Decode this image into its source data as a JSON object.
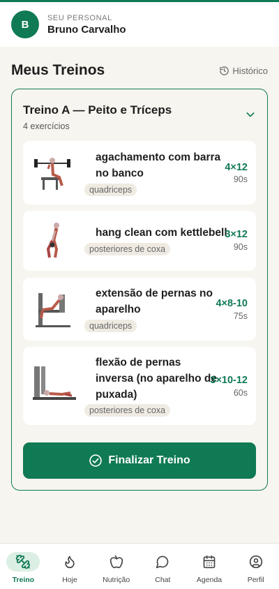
{
  "header": {
    "avatar_initial": "B",
    "role_label": "SEU PERSONAL",
    "trainer_name": "Bruno Carvalho"
  },
  "page": {
    "title": "Meus Treinos",
    "history_label": "Histórico"
  },
  "workout": {
    "name": "Treino A — Peito e Tríceps",
    "count": "4 exercícios",
    "exercises": [
      {
        "name_line1": "agachamento com barra",
        "name_line2": "no banco",
        "name_line3": "",
        "tag": "quadriceps",
        "sets": "4×12",
        "rest": "90s",
        "image": "squat-figure"
      },
      {
        "name_line1": "hang clean com kettlebell",
        "name_line2": "",
        "name_line3": "",
        "tag": "posteriores de coxa",
        "sets": "3×12",
        "rest": "90s",
        "image": "kettlebell-figure"
      },
      {
        "name_line1": "extensão de pernas no",
        "name_line2": "aparelho",
        "name_line3": "",
        "tag": "quadriceps",
        "sets": "4×8-10",
        "rest": "75s",
        "image": "leg-extension-figure"
      },
      {
        "name_line1": "flexão de pernas",
        "name_line2": "inversa (no aparelho de",
        "name_line3": "puxada)",
        "tag": "posteriores de coxa",
        "sets": "3×10-12",
        "rest": "60s",
        "image": "leg-curl-figure"
      }
    ],
    "finish_label": "Finalizar Treino"
  },
  "nav": {
    "items": [
      {
        "label": "Treino",
        "icon": "dumbbell-icon",
        "active": true
      },
      {
        "label": "Hoje",
        "icon": "flame-icon",
        "active": false
      },
      {
        "label": "Nutrição",
        "icon": "apple-icon",
        "active": false
      },
      {
        "label": "Chat",
        "icon": "chat-bubble-icon",
        "active": false
      },
      {
        "label": "Agenda",
        "icon": "calendar-icon",
        "active": false
      },
      {
        "label": "Perfil",
        "icon": "profile-icon",
        "active": false
      }
    ]
  },
  "colors": {
    "accent": "#0f7a54",
    "background": "#f7f5ef",
    "tag_bg": "#efebe3"
  }
}
